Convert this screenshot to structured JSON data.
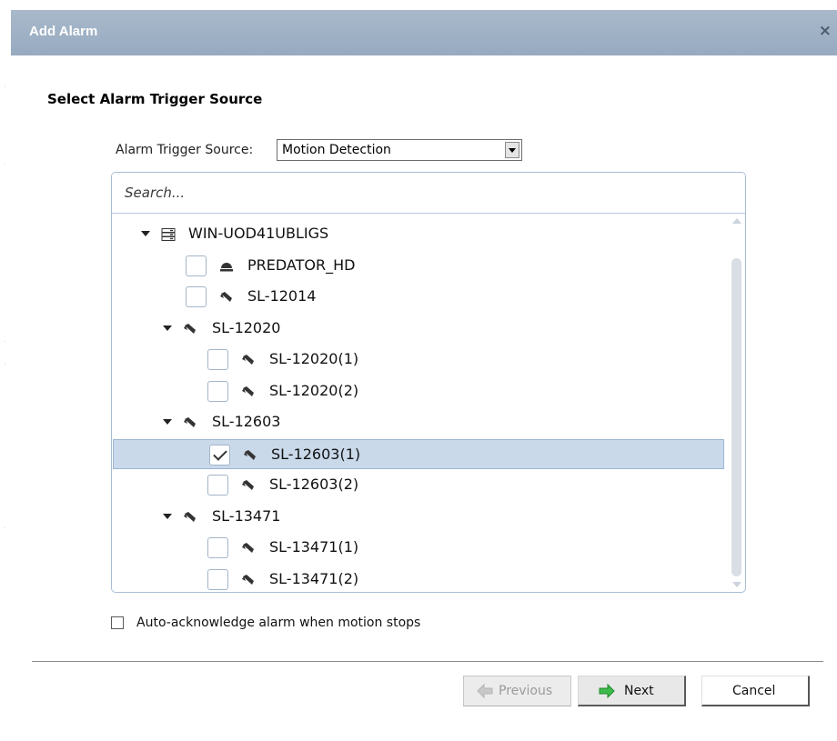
{
  "dialog": {
    "title": "Add Alarm",
    "close_glyph": "×",
    "section_title": "Select Alarm Trigger Source"
  },
  "source": {
    "label": "Alarm Trigger Source:",
    "value": "Motion Detection"
  },
  "search": {
    "placeholder": "Search..."
  },
  "tree": [
    {
      "label": "WIN-UOD41UBLIGS",
      "icon": "server-icon",
      "expandable": true,
      "checkbox": false,
      "checked": false
    },
    {
      "label": "PREDATOR_HD",
      "icon": "dome-camera-icon",
      "expandable": false,
      "checkbox": true,
      "checked": false
    },
    {
      "label": "SL-12014",
      "icon": "camera-icon",
      "expandable": false,
      "checkbox": true,
      "checked": false
    },
    {
      "label": "SL-12020",
      "icon": "camera-icon",
      "expandable": true,
      "checkbox": false,
      "checked": false
    },
    {
      "label": "SL-12020(1)",
      "icon": "camera-icon",
      "expandable": false,
      "checkbox": true,
      "checked": false
    },
    {
      "label": "SL-12020(2)",
      "icon": "camera-icon",
      "expandable": false,
      "checkbox": true,
      "checked": false
    },
    {
      "label": "SL-12603",
      "icon": "camera-icon",
      "expandable": true,
      "checkbox": false,
      "checked": false
    },
    {
      "label": "SL-12603(1)",
      "icon": "camera-icon",
      "expandable": false,
      "checkbox": true,
      "checked": true,
      "selected": true
    },
    {
      "label": "SL-12603(2)",
      "icon": "camera-icon",
      "expandable": false,
      "checkbox": true,
      "checked": false
    },
    {
      "label": "SL-13471",
      "icon": "camera-icon",
      "expandable": true,
      "checkbox": false,
      "checked": false
    },
    {
      "label": "SL-13471(1)",
      "icon": "camera-icon",
      "expandable": false,
      "checkbox": true,
      "checked": false
    },
    {
      "label": "SL-13471(2)",
      "icon": "camera-icon",
      "expandable": false,
      "checkbox": true,
      "checked": false
    }
  ],
  "auto_ack": {
    "label": "Auto-acknowledge alarm when motion stops",
    "checked": false
  },
  "buttons": {
    "previous": "Previous",
    "next": "Next",
    "cancel": "Cancel"
  },
  "colors": {
    "title_bar": "#a2b4c8",
    "selection": "#c9d9ea",
    "next_arrow": "#39b54a"
  }
}
